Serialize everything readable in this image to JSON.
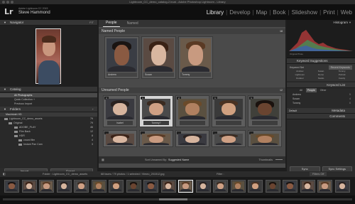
{
  "window": {
    "title": "Lightroom_CC_demo_catalog-2.lrcat - Adobe Photoshop Lightroom - Library"
  },
  "identity": {
    "logo": "Lr",
    "subtitle": "Adobe Lightroom CC 2015",
    "name": "Steve Hammond"
  },
  "modules": [
    "Library",
    "Develop",
    "Map",
    "Book",
    "Slideshow",
    "Print",
    "Web"
  ],
  "active_module": "Library",
  "left": {
    "navigator": {
      "label": "Navigator",
      "zoom": "FIT"
    },
    "catalog": {
      "label": "Catalog",
      "rows": [
        {
          "label": "All Photographs",
          "count": "",
          "selected": true
        },
        {
          "label": "Quick Collection +",
          "count": ""
        },
        {
          "label": "Previous Import",
          "count": ""
        }
      ]
    },
    "folders": {
      "label": "Folders",
      "volume": "Macintosh HD",
      "volume_info": "",
      "rows": [
        {
          "label": "Lightroom_CC_demo_assets",
          "count": "79"
        },
        {
          "label": "Original",
          "count": "79"
        },
        {
          "label": "ADOBE_PLAY",
          "count": "46"
        },
        {
          "label": "Film Back",
          "count": "12"
        },
        {
          "label": "HDR",
          "count": "8"
        },
        {
          "label": "crowd film",
          "count": "4"
        },
        {
          "label": "Instant Pan Cam",
          "count": "3"
        }
      ]
    },
    "buttons": {
      "import": "Import...",
      "export": "Export..."
    }
  },
  "center": {
    "tabs": [
      "People",
      "Named"
    ],
    "named_header": "Named People",
    "named_count": "18",
    "named_cards": [
      {
        "label": "Andrew"
      },
      {
        "label": "Susan"
      },
      {
        "label": "Tommy"
      }
    ],
    "unnamed_header": "Unnamed People",
    "unnamed_count": "12",
    "unnamed_cards": [
      {
        "label": "Isabel",
        "n": "2"
      },
      {
        "label": "Tommy?",
        "n": "1",
        "selected": true
      },
      {
        "label": "",
        "n": "2"
      },
      {
        "label": "",
        "n": "1"
      },
      {
        "label": "",
        "n": "1"
      }
    ],
    "toolbar": {
      "sort_label": "Sort Unnamed By:",
      "sort_value": "Suggested Name",
      "thumbnails": "Thumbnails"
    }
  },
  "right": {
    "histogram": {
      "label": "Histogram",
      "info": "Original Photo"
    },
    "keyword_suggestions": {
      "label": "Keyword Suggestions",
      "rows": [
        "Keyword Set",
        "Recent Keywords"
      ],
      "grid": [
        "Andrew",
        "Susan",
        "Tommy",
        "Lightroom",
        "Demo",
        "Portrait",
        "Outdoor",
        "Studio",
        "Family"
      ]
    },
    "keyword_list": {
      "label": "Keyword List",
      "tabs": [
        "All",
        "People",
        "Other"
      ],
      "rows": [
        {
          "label": "Andrew",
          "count": "5"
        },
        {
          "label": "Susan",
          "count": "4"
        },
        {
          "label": "Tommy",
          "count": "6"
        }
      ]
    },
    "metadata": "Metadata",
    "default": "Default",
    "comments": "Comments",
    "buttons": {
      "sync": "Sync",
      "sync_settings": "Sync Settings"
    }
  },
  "filmbar": {
    "path": "Folder : Lightroom_CC_demo_assets",
    "summary": "68 faces / 79 photos / 1 selected / Vimeo_201512.jpg",
    "filter": "Filter :",
    "filter_value": "Filters Off"
  },
  "colors": {
    "accent": "#e6e6e6",
    "panel": "#292929",
    "center": "#4a4a4a"
  }
}
